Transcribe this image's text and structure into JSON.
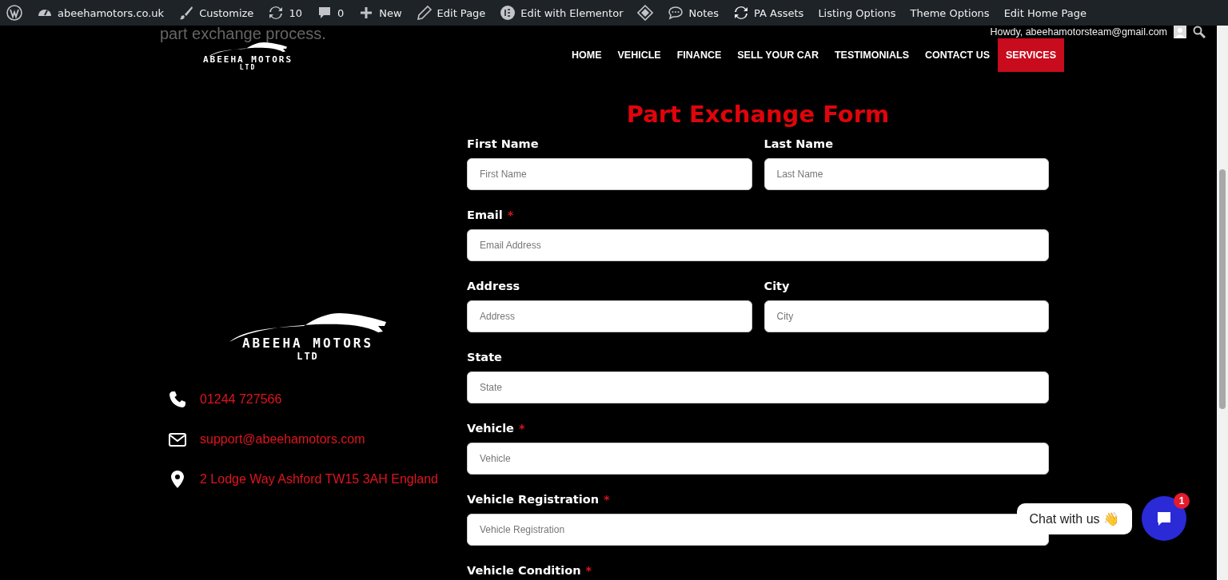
{
  "admin_bar": {
    "items": [
      {
        "label": "abeehamotors.co.uk"
      },
      {
        "label": "Customize"
      },
      {
        "label": "10"
      },
      {
        "label": "0"
      },
      {
        "label": "New"
      },
      {
        "label": "Edit Page"
      },
      {
        "label": "Edit with Elementor"
      },
      {
        "label": "Notes"
      },
      {
        "label": "PA Assets"
      },
      {
        "label": "Listing Options"
      },
      {
        "label": "Theme Options"
      },
      {
        "label": "Edit Home Page"
      }
    ],
    "greeting": "Howdy, abeehamotorsteam@gmail.com"
  },
  "intro_text": "part exchange process.",
  "header_logo": {
    "name": "ABEEHA MOTORS",
    "suffix": "LTD"
  },
  "nav": [
    {
      "label": "HOME",
      "selected": false
    },
    {
      "label": "VEHICLE",
      "selected": false
    },
    {
      "label": "FINANCE",
      "selected": false
    },
    {
      "label": "SELL YOUR CAR",
      "selected": false
    },
    {
      "label": "TESTIMONIALS",
      "selected": false
    },
    {
      "label": "CONTACT US",
      "selected": false
    },
    {
      "label": "SERVICES",
      "selected": true
    }
  ],
  "contact_logo": {
    "name": "ABEEHA MOTORS",
    "suffix": "LTD"
  },
  "contact": [
    {
      "kind": "phone",
      "text": "01244 727566"
    },
    {
      "kind": "email",
      "text": "support@abeehamotors.com"
    },
    {
      "kind": "location",
      "text": "2 Lodge Way Ashford TW15 3AH England"
    }
  ],
  "form": {
    "title": "Part Exchange Form",
    "rows": [
      [
        {
          "label": "First Name",
          "placeholder": "First Name"
        },
        {
          "label": "Last Name",
          "placeholder": "Last Name"
        }
      ],
      [
        {
          "label": "Email",
          "required_mark": "*",
          "placeholder": "Email Address"
        }
      ],
      [
        {
          "label": "Address",
          "placeholder": "Address"
        },
        {
          "label": "City",
          "placeholder": "City"
        }
      ],
      [
        {
          "label": "State",
          "placeholder": "State"
        }
      ],
      [
        {
          "label": "Vehicle",
          "required_mark": "*",
          "placeholder": "Vehicle"
        }
      ],
      [
        {
          "label": "Vehicle Registration",
          "required_mark": "*",
          "placeholder": "Vehicle Registration"
        }
      ],
      [
        {
          "label": "Vehicle Condition",
          "required_mark": "*"
        }
      ]
    ]
  },
  "chat": {
    "prompt": "Chat with us 👋",
    "badge": "1"
  }
}
